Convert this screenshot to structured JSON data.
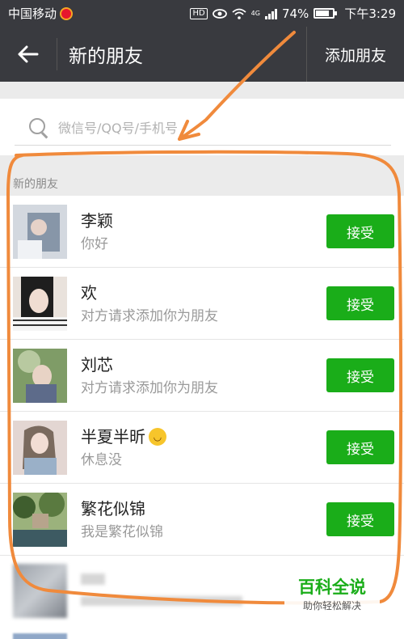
{
  "status_bar": {
    "carrier": "中国移动",
    "network": "4G",
    "hd": "HD",
    "battery": "74%",
    "time": "下午3:29"
  },
  "navbar": {
    "back_icon": "arrow-left-icon",
    "title": "新的朋友",
    "add_label": "添加朋友"
  },
  "search": {
    "placeholder": "微信号/QQ号/手机号"
  },
  "section": {
    "header": "新的朋友"
  },
  "friends": [
    {
      "name": "李颖",
      "message": "你好",
      "button": "接受",
      "avatar_colors": [
        "#c9cfd8",
        "#8b98a8"
      ]
    },
    {
      "name": "欢",
      "message": "对方请求添加你为朋友",
      "button": "接受",
      "avatar_colors": [
        "#2a2a2a",
        "#e8d8d0"
      ]
    },
    {
      "name": "刘芯",
      "message": "对方请求添加你为朋友",
      "button": "接受",
      "avatar_colors": [
        "#6f8f5a",
        "#cfd7c1"
      ]
    },
    {
      "name": "半夏半昕",
      "message": "休息没",
      "button": "接受",
      "avatar_colors": [
        "#d8c3be",
        "#7c6e74"
      ]
    },
    {
      "name": "繁花似锦",
      "message": "我是繁花似锦",
      "button": "接受",
      "avatar_colors": [
        "#4e6e3a",
        "#9bb27c"
      ]
    }
  ],
  "watermark": {
    "title": "百科全说",
    "subtitle": "助你轻松解决"
  },
  "colors": {
    "navbar": "#393a3f",
    "accept": "#1aad19",
    "annotation": "#f08a3c"
  }
}
